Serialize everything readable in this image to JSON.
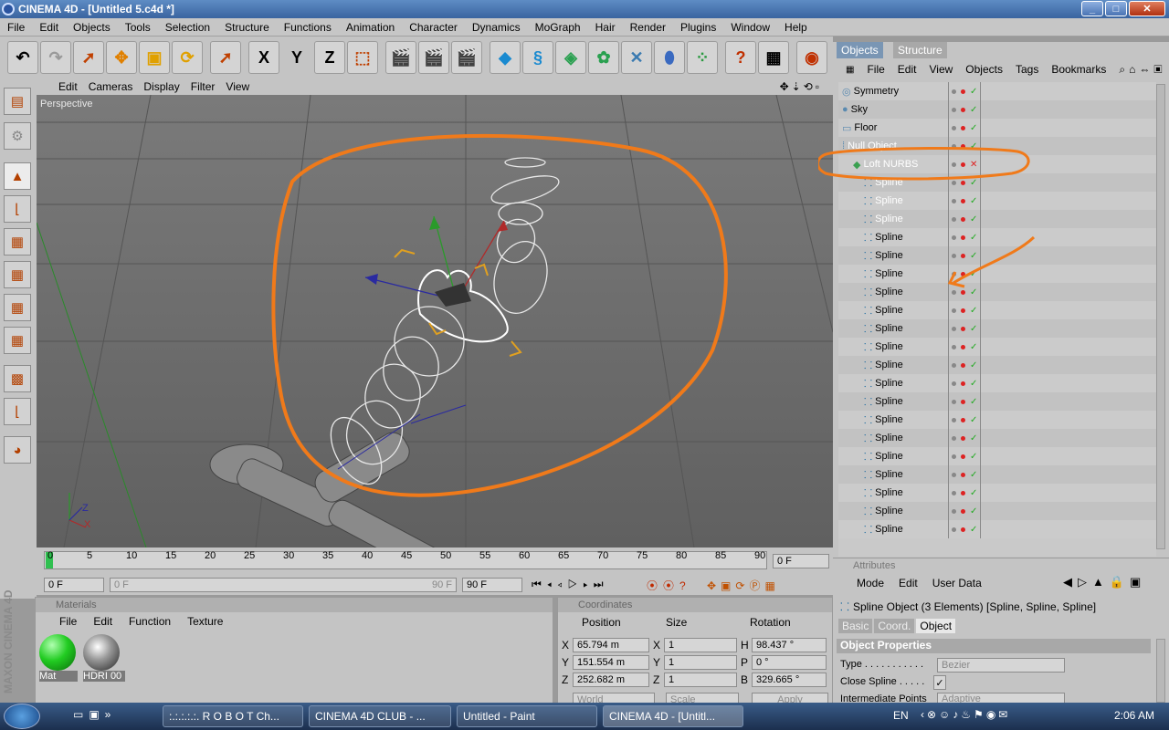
{
  "window": {
    "title": "CINEMA 4D - [Untitled 5.c4d *]",
    "min": "_",
    "max": "□",
    "close": "✕"
  },
  "menu": [
    "File",
    "Edit",
    "Objects",
    "Tools",
    "Selection",
    "Structure",
    "Functions",
    "Animation",
    "Character",
    "Dynamics",
    "MoGraph",
    "Hair",
    "Render",
    "Plugins",
    "Window",
    "Help"
  ],
  "toolbar": {
    "x_label": "X",
    "y_label": "Y",
    "z_label": "Z"
  },
  "viewport": {
    "menu": [
      "Edit",
      "Cameras",
      "Display",
      "Filter",
      "View"
    ],
    "label": "Perspective",
    "annotation_color": "#f07a1a"
  },
  "timeline": {
    "ticks": [
      "0",
      "5",
      "10",
      "15",
      "20",
      "25",
      "30",
      "35",
      "40",
      "45",
      "50",
      "55",
      "60",
      "65",
      "70",
      "75",
      "80",
      "85",
      "90"
    ],
    "frame": "0 F"
  },
  "anim": {
    "start": "0 F",
    "slider_start": "0 F",
    "slider_end": "90 F",
    "end": "90 F"
  },
  "materials": {
    "title": "Materials",
    "menu": [
      "File",
      "Edit",
      "Function",
      "Texture"
    ],
    "items": [
      {
        "name": "Mat",
        "color": "#22cc22"
      },
      {
        "name": "HDRI 00"
      }
    ]
  },
  "coords": {
    "title": "Coordinates",
    "headers": [
      "Position",
      "Size",
      "Rotation"
    ],
    "rows": [
      {
        "axis": "X",
        "pos": "65.794 m",
        "saxis": "X",
        "size": "1",
        "raxis": "H",
        "rot": "98.437 °"
      },
      {
        "axis": "Y",
        "pos": "151.554 m",
        "saxis": "Y",
        "size": "1",
        "raxis": "P",
        "rot": "0 °"
      },
      {
        "axis": "Z",
        "pos": "252.682 m",
        "saxis": "Z",
        "size": "1",
        "raxis": "B",
        "rot": "329.665 °"
      }
    ],
    "world": "World",
    "scale": "Scale",
    "apply": "Apply"
  },
  "objects": {
    "tabs": [
      "Objects",
      "Structure"
    ],
    "menu": [
      "File",
      "Edit",
      "View",
      "Objects",
      "Tags",
      "Bookmarks"
    ],
    "items": [
      {
        "name": "Symmetry",
        "indent": 0
      },
      {
        "name": "Sky",
        "indent": 0
      },
      {
        "name": "Floor",
        "indent": 0
      },
      {
        "name": "Null Object",
        "indent": 0
      },
      {
        "name": "Loft NURBS",
        "indent": 1
      },
      {
        "name": "Spline",
        "indent": 2
      },
      {
        "name": "Spline",
        "indent": 2
      },
      {
        "name": "Spline",
        "indent": 2
      },
      {
        "name": "Spline",
        "indent": 2
      },
      {
        "name": "Spline",
        "indent": 2
      },
      {
        "name": "Spline",
        "indent": 2
      },
      {
        "name": "Spline",
        "indent": 2
      },
      {
        "name": "Spline",
        "indent": 2
      },
      {
        "name": "Spline",
        "indent": 2
      },
      {
        "name": "Spline",
        "indent": 2
      },
      {
        "name": "Spline",
        "indent": 2
      },
      {
        "name": "Spline",
        "indent": 2
      },
      {
        "name": "Spline",
        "indent": 2
      },
      {
        "name": "Spline",
        "indent": 2
      },
      {
        "name": "Spline",
        "indent": 2
      },
      {
        "name": "Spline",
        "indent": 2
      },
      {
        "name": "Spline",
        "indent": 2
      },
      {
        "name": "Spline",
        "indent": 2
      },
      {
        "name": "Spline",
        "indent": 2
      },
      {
        "name": "Spline",
        "indent": 2
      }
    ]
  },
  "attributes": {
    "title": "Attributes",
    "menu": [
      "Mode",
      "Edit",
      "User Data"
    ],
    "object_info": "Spline Object (3 Elements) [Spline, Spline, Spline]",
    "tabs": [
      "Basic",
      "Coord.",
      "Object"
    ],
    "section": "Object Properties",
    "props": [
      {
        "label": "Type . . . . . . . . . . .",
        "value": "Bezier"
      },
      {
        "label": "Close Spline . . . . .",
        "value": "✓"
      },
      {
        "label": "Intermediate Points",
        "value": "Adaptive"
      }
    ]
  },
  "taskbar": {
    "tasks": [
      ":.:.:.:.:. R O B O T Ch...",
      "CINEMA 4D CLUB - ...",
      "Untitled - Paint",
      "CINEMA 4D - [Untitl..."
    ],
    "lang": "EN",
    "clock": "2:06 AM"
  },
  "brand": "MAXON CINEMA 4D"
}
